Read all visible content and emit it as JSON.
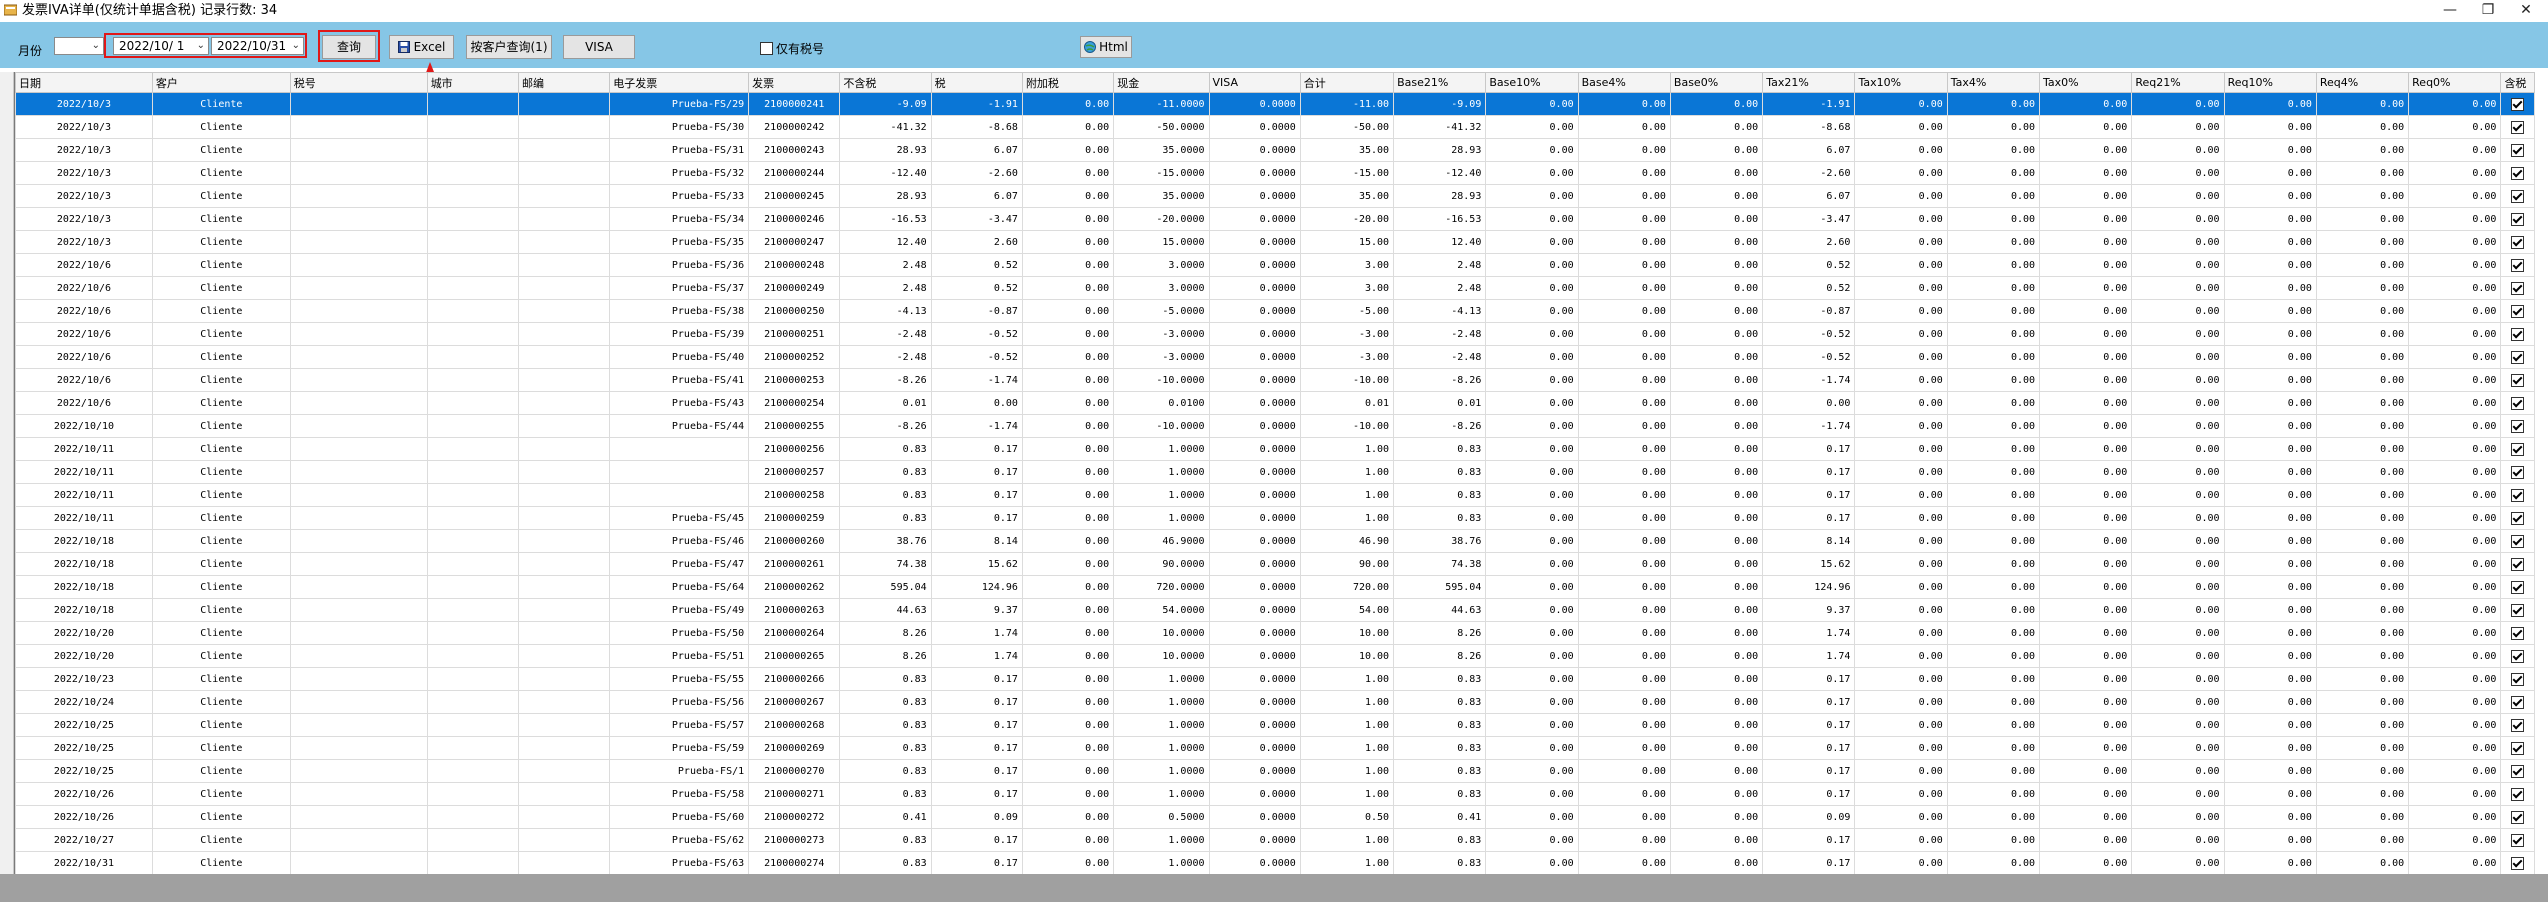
{
  "window": {
    "title": "发票IVA详单(仅统计单据含税) 记录行数: 34",
    "minimize": "—",
    "maximize": "❐",
    "close": "✕"
  },
  "toolbar": {
    "month_label": "月份",
    "month_value": "",
    "date_from": "2022/10/ 1",
    "date_to": "2022/10/31",
    "query_btn": "查询",
    "excel_btn": "Excel",
    "customer_query_btn": "按客户查询(1)",
    "visa_btn": "VISA",
    "only_tax_label": "仅有税号",
    "html_btn": "Html"
  },
  "colors": {
    "accent": "#86c6e6",
    "selected": "#0a76d6",
    "highlight": "#e01818"
  },
  "table": {
    "columns": [
      "日期",
      "客户",
      "税号",
      "城市",
      "邮编",
      "电子发票",
      "发票",
      "不含税",
      "税",
      "附加税",
      "现金",
      "VISA",
      "合计",
      "Base21%",
      "Base10%",
      "Base4%",
      "Base0%",
      "Tax21%",
      "Tax10%",
      "Tax4%",
      "Tax0%",
      "Req21%",
      "Req10%",
      "Req4%",
      "Req0%",
      "含税"
    ],
    "rows": [
      [
        "2022/10/3",
        "Cliente",
        "",
        "",
        "",
        "Prueba-FS/29",
        "2100000241",
        "-9.09",
        "-1.91",
        "0.00",
        "-11.0000",
        "0.0000",
        "-11.00",
        "-9.09",
        "0.00",
        "0.00",
        "0.00",
        "-1.91",
        "0.00",
        "0.00",
        "0.00",
        "0.00",
        "0.00",
        "0.00",
        "0.00"
      ],
      [
        "2022/10/3",
        "Cliente",
        "",
        "",
        "",
        "Prueba-FS/30",
        "2100000242",
        "-41.32",
        "-8.68",
        "0.00",
        "-50.0000",
        "0.0000",
        "-50.00",
        "-41.32",
        "0.00",
        "0.00",
        "0.00",
        "-8.68",
        "0.00",
        "0.00",
        "0.00",
        "0.00",
        "0.00",
        "0.00",
        "0.00"
      ],
      [
        "2022/10/3",
        "Cliente",
        "",
        "",
        "",
        "Prueba-FS/31",
        "2100000243",
        "28.93",
        "6.07",
        "0.00",
        "35.0000",
        "0.0000",
        "35.00",
        "28.93",
        "0.00",
        "0.00",
        "0.00",
        "6.07",
        "0.00",
        "0.00",
        "0.00",
        "0.00",
        "0.00",
        "0.00",
        "0.00"
      ],
      [
        "2022/10/3",
        "Cliente",
        "",
        "",
        "",
        "Prueba-FS/32",
        "2100000244",
        "-12.40",
        "-2.60",
        "0.00",
        "-15.0000",
        "0.0000",
        "-15.00",
        "-12.40",
        "0.00",
        "0.00",
        "0.00",
        "-2.60",
        "0.00",
        "0.00",
        "0.00",
        "0.00",
        "0.00",
        "0.00",
        "0.00"
      ],
      [
        "2022/10/3",
        "Cliente",
        "",
        "",
        "",
        "Prueba-FS/33",
        "2100000245",
        "28.93",
        "6.07",
        "0.00",
        "35.0000",
        "0.0000",
        "35.00",
        "28.93",
        "0.00",
        "0.00",
        "0.00",
        "6.07",
        "0.00",
        "0.00",
        "0.00",
        "0.00",
        "0.00",
        "0.00",
        "0.00"
      ],
      [
        "2022/10/3",
        "Cliente",
        "",
        "",
        "",
        "Prueba-FS/34",
        "2100000246",
        "-16.53",
        "-3.47",
        "0.00",
        "-20.0000",
        "0.0000",
        "-20.00",
        "-16.53",
        "0.00",
        "0.00",
        "0.00",
        "-3.47",
        "0.00",
        "0.00",
        "0.00",
        "0.00",
        "0.00",
        "0.00",
        "0.00"
      ],
      [
        "2022/10/3",
        "Cliente",
        "",
        "",
        "",
        "Prueba-FS/35",
        "2100000247",
        "12.40",
        "2.60",
        "0.00",
        "15.0000",
        "0.0000",
        "15.00",
        "12.40",
        "0.00",
        "0.00",
        "0.00",
        "2.60",
        "0.00",
        "0.00",
        "0.00",
        "0.00",
        "0.00",
        "0.00",
        "0.00"
      ],
      [
        "2022/10/6",
        "Cliente",
        "",
        "",
        "",
        "Prueba-FS/36",
        "2100000248",
        "2.48",
        "0.52",
        "0.00",
        "3.0000",
        "0.0000",
        "3.00",
        "2.48",
        "0.00",
        "0.00",
        "0.00",
        "0.52",
        "0.00",
        "0.00",
        "0.00",
        "0.00",
        "0.00",
        "0.00",
        "0.00"
      ],
      [
        "2022/10/6",
        "Cliente",
        "",
        "",
        "",
        "Prueba-FS/37",
        "2100000249",
        "2.48",
        "0.52",
        "0.00",
        "3.0000",
        "0.0000",
        "3.00",
        "2.48",
        "0.00",
        "0.00",
        "0.00",
        "0.52",
        "0.00",
        "0.00",
        "0.00",
        "0.00",
        "0.00",
        "0.00",
        "0.00"
      ],
      [
        "2022/10/6",
        "Cliente",
        "",
        "",
        "",
        "Prueba-FS/38",
        "2100000250",
        "-4.13",
        "-0.87",
        "0.00",
        "-5.0000",
        "0.0000",
        "-5.00",
        "-4.13",
        "0.00",
        "0.00",
        "0.00",
        "-0.87",
        "0.00",
        "0.00",
        "0.00",
        "0.00",
        "0.00",
        "0.00",
        "0.00"
      ],
      [
        "2022/10/6",
        "Cliente",
        "",
        "",
        "",
        "Prueba-FS/39",
        "2100000251",
        "-2.48",
        "-0.52",
        "0.00",
        "-3.0000",
        "0.0000",
        "-3.00",
        "-2.48",
        "0.00",
        "0.00",
        "0.00",
        "-0.52",
        "0.00",
        "0.00",
        "0.00",
        "0.00",
        "0.00",
        "0.00",
        "0.00"
      ],
      [
        "2022/10/6",
        "Cliente",
        "",
        "",
        "",
        "Prueba-FS/40",
        "2100000252",
        "-2.48",
        "-0.52",
        "0.00",
        "-3.0000",
        "0.0000",
        "-3.00",
        "-2.48",
        "0.00",
        "0.00",
        "0.00",
        "-0.52",
        "0.00",
        "0.00",
        "0.00",
        "0.00",
        "0.00",
        "0.00",
        "0.00"
      ],
      [
        "2022/10/6",
        "Cliente",
        "",
        "",
        "",
        "Prueba-FS/41",
        "2100000253",
        "-8.26",
        "-1.74",
        "0.00",
        "-10.0000",
        "0.0000",
        "-10.00",
        "-8.26",
        "0.00",
        "0.00",
        "0.00",
        "-1.74",
        "0.00",
        "0.00",
        "0.00",
        "0.00",
        "0.00",
        "0.00",
        "0.00"
      ],
      [
        "2022/10/6",
        "Cliente",
        "",
        "",
        "",
        "Prueba-FS/43",
        "2100000254",
        "0.01",
        "0.00",
        "0.00",
        "0.0100",
        "0.0000",
        "0.01",
        "0.01",
        "0.00",
        "0.00",
        "0.00",
        "0.00",
        "0.00",
        "0.00",
        "0.00",
        "0.00",
        "0.00",
        "0.00",
        "0.00"
      ],
      [
        "2022/10/10",
        "Cliente",
        "",
        "",
        "",
        "Prueba-FS/44",
        "2100000255",
        "-8.26",
        "-1.74",
        "0.00",
        "-10.0000",
        "0.0000",
        "-10.00",
        "-8.26",
        "0.00",
        "0.00",
        "0.00",
        "-1.74",
        "0.00",
        "0.00",
        "0.00",
        "0.00",
        "0.00",
        "0.00",
        "0.00"
      ],
      [
        "2022/10/11",
        "Cliente",
        "",
        "",
        "",
        "",
        "2100000256",
        "0.83",
        "0.17",
        "0.00",
        "1.0000",
        "0.0000",
        "1.00",
        "0.83",
        "0.00",
        "0.00",
        "0.00",
        "0.17",
        "0.00",
        "0.00",
        "0.00",
        "0.00",
        "0.00",
        "0.00",
        "0.00"
      ],
      [
        "2022/10/11",
        "Cliente",
        "",
        "",
        "",
        "",
        "2100000257",
        "0.83",
        "0.17",
        "0.00",
        "1.0000",
        "0.0000",
        "1.00",
        "0.83",
        "0.00",
        "0.00",
        "0.00",
        "0.17",
        "0.00",
        "0.00",
        "0.00",
        "0.00",
        "0.00",
        "0.00",
        "0.00"
      ],
      [
        "2022/10/11",
        "Cliente",
        "",
        "",
        "",
        "",
        "2100000258",
        "0.83",
        "0.17",
        "0.00",
        "1.0000",
        "0.0000",
        "1.00",
        "0.83",
        "0.00",
        "0.00",
        "0.00",
        "0.17",
        "0.00",
        "0.00",
        "0.00",
        "0.00",
        "0.00",
        "0.00",
        "0.00"
      ],
      [
        "2022/10/11",
        "Cliente",
        "",
        "",
        "",
        "Prueba-FS/45",
        "2100000259",
        "0.83",
        "0.17",
        "0.00",
        "1.0000",
        "0.0000",
        "1.00",
        "0.83",
        "0.00",
        "0.00",
        "0.00",
        "0.17",
        "0.00",
        "0.00",
        "0.00",
        "0.00",
        "0.00",
        "0.00",
        "0.00"
      ],
      [
        "2022/10/18",
        "Cliente",
        "",
        "",
        "",
        "Prueba-FS/46",
        "2100000260",
        "38.76",
        "8.14",
        "0.00",
        "46.9000",
        "0.0000",
        "46.90",
        "38.76",
        "0.00",
        "0.00",
        "0.00",
        "8.14",
        "0.00",
        "0.00",
        "0.00",
        "0.00",
        "0.00",
        "0.00",
        "0.00"
      ],
      [
        "2022/10/18",
        "Cliente",
        "",
        "",
        "",
        "Prueba-FS/47",
        "2100000261",
        "74.38",
        "15.62",
        "0.00",
        "90.0000",
        "0.0000",
        "90.00",
        "74.38",
        "0.00",
        "0.00",
        "0.00",
        "15.62",
        "0.00",
        "0.00",
        "0.00",
        "0.00",
        "0.00",
        "0.00",
        "0.00"
      ],
      [
        "2022/10/18",
        "Cliente",
        "",
        "",
        "",
        "Prueba-FS/64",
        "2100000262",
        "595.04",
        "124.96",
        "0.00",
        "720.0000",
        "0.0000",
        "720.00",
        "595.04",
        "0.00",
        "0.00",
        "0.00",
        "124.96",
        "0.00",
        "0.00",
        "0.00",
        "0.00",
        "0.00",
        "0.00",
        "0.00"
      ],
      [
        "2022/10/18",
        "Cliente",
        "",
        "",
        "",
        "Prueba-FS/49",
        "2100000263",
        "44.63",
        "9.37",
        "0.00",
        "54.0000",
        "0.0000",
        "54.00",
        "44.63",
        "0.00",
        "0.00",
        "0.00",
        "9.37",
        "0.00",
        "0.00",
        "0.00",
        "0.00",
        "0.00",
        "0.00",
        "0.00"
      ],
      [
        "2022/10/20",
        "Cliente",
        "",
        "",
        "",
        "Prueba-FS/50",
        "2100000264",
        "8.26",
        "1.74",
        "0.00",
        "10.0000",
        "0.0000",
        "10.00",
        "8.26",
        "0.00",
        "0.00",
        "0.00",
        "1.74",
        "0.00",
        "0.00",
        "0.00",
        "0.00",
        "0.00",
        "0.00",
        "0.00"
      ],
      [
        "2022/10/20",
        "Cliente",
        "",
        "",
        "",
        "Prueba-FS/51",
        "2100000265",
        "8.26",
        "1.74",
        "0.00",
        "10.0000",
        "0.0000",
        "10.00",
        "8.26",
        "0.00",
        "0.00",
        "0.00",
        "1.74",
        "0.00",
        "0.00",
        "0.00",
        "0.00",
        "0.00",
        "0.00",
        "0.00"
      ],
      [
        "2022/10/23",
        "Cliente",
        "",
        "",
        "",
        "Prueba-FS/55",
        "2100000266",
        "0.83",
        "0.17",
        "0.00",
        "1.0000",
        "0.0000",
        "1.00",
        "0.83",
        "0.00",
        "0.00",
        "0.00",
        "0.17",
        "0.00",
        "0.00",
        "0.00",
        "0.00",
        "0.00",
        "0.00",
        "0.00"
      ],
      [
        "2022/10/24",
        "Cliente",
        "",
        "",
        "",
        "Prueba-FS/56",
        "2100000267",
        "0.83",
        "0.17",
        "0.00",
        "1.0000",
        "0.0000",
        "1.00",
        "0.83",
        "0.00",
        "0.00",
        "0.00",
        "0.17",
        "0.00",
        "0.00",
        "0.00",
        "0.00",
        "0.00",
        "0.00",
        "0.00"
      ],
      [
        "2022/10/25",
        "Cliente",
        "",
        "",
        "",
        "Prueba-FS/57",
        "2100000268",
        "0.83",
        "0.17",
        "0.00",
        "1.0000",
        "0.0000",
        "1.00",
        "0.83",
        "0.00",
        "0.00",
        "0.00",
        "0.17",
        "0.00",
        "0.00",
        "0.00",
        "0.00",
        "0.00",
        "0.00",
        "0.00"
      ],
      [
        "2022/10/25",
        "Cliente",
        "",
        "",
        "",
        "Prueba-FS/59",
        "2100000269",
        "0.83",
        "0.17",
        "0.00",
        "1.0000",
        "0.0000",
        "1.00",
        "0.83",
        "0.00",
        "0.00",
        "0.00",
        "0.17",
        "0.00",
        "0.00",
        "0.00",
        "0.00",
        "0.00",
        "0.00",
        "0.00"
      ],
      [
        "2022/10/25",
        "Cliente",
        "",
        "",
        "",
        "Prueba-FS/1",
        "2100000270",
        "0.83",
        "0.17",
        "0.00",
        "1.0000",
        "0.0000",
        "1.00",
        "0.83",
        "0.00",
        "0.00",
        "0.00",
        "0.17",
        "0.00",
        "0.00",
        "0.00",
        "0.00",
        "0.00",
        "0.00",
        "0.00"
      ],
      [
        "2022/10/26",
        "Cliente",
        "",
        "",
        "",
        "Prueba-FS/58",
        "2100000271",
        "0.83",
        "0.17",
        "0.00",
        "1.0000",
        "0.0000",
        "1.00",
        "0.83",
        "0.00",
        "0.00",
        "0.00",
        "0.17",
        "0.00",
        "0.00",
        "0.00",
        "0.00",
        "0.00",
        "0.00",
        "0.00"
      ],
      [
        "2022/10/26",
        "Cliente",
        "",
        "",
        "",
        "Prueba-FS/60",
        "2100000272",
        "0.41",
        "0.09",
        "0.00",
        "0.5000",
        "0.0000",
        "0.50",
        "0.41",
        "0.00",
        "0.00",
        "0.00",
        "0.09",
        "0.00",
        "0.00",
        "0.00",
        "0.00",
        "0.00",
        "0.00",
        "0.00"
      ],
      [
        "2022/10/27",
        "Cliente",
        "",
        "",
        "",
        "Prueba-FS/62",
        "2100000273",
        "0.83",
        "0.17",
        "0.00",
        "1.0000",
        "0.0000",
        "1.00",
        "0.83",
        "0.00",
        "0.00",
        "0.00",
        "0.17",
        "0.00",
        "0.00",
        "0.00",
        "0.00",
        "0.00",
        "0.00",
        "0.00"
      ],
      [
        "2022/10/31",
        "Cliente",
        "",
        "",
        "",
        "Prueba-FS/63",
        "2100000274",
        "0.83",
        "0.17",
        "0.00",
        "1.0000",
        "0.0000",
        "1.00",
        "0.83",
        "0.00",
        "0.00",
        "0.00",
        "0.17",
        "0.00",
        "0.00",
        "0.00",
        "0.00",
        "0.00",
        "0.00",
        "0.00"
      ]
    ]
  }
}
